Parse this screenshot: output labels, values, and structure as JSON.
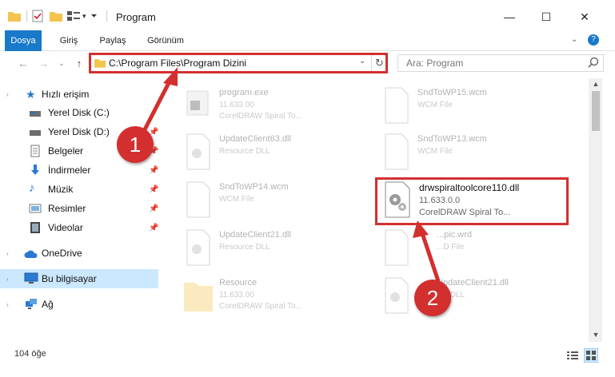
{
  "window": {
    "title": "Program",
    "minimize_glyph": "—",
    "maximize_glyph": "☐",
    "close_glyph": "✕"
  },
  "ribbon": {
    "tabs": [
      {
        "label": "Dosya",
        "active": true
      },
      {
        "label": "Giriş"
      },
      {
        "label": "Paylaş"
      },
      {
        "label": "Görünüm"
      }
    ]
  },
  "address": {
    "path": "C:\\Program Files\\Program Dizini",
    "search_placeholder": "Ara: Program"
  },
  "sidebar": {
    "items": [
      {
        "label": "Hızlı erişim",
        "icon": "star-icon"
      },
      {
        "label": "Yerel Disk (C:)",
        "icon": "drive-icon"
      },
      {
        "label": "Yerel Disk (D:)",
        "icon": "drive-icon",
        "pinned": true
      },
      {
        "label": "Belgeler",
        "icon": "documents-icon",
        "pinned": true
      },
      {
        "label": "İndirmeler",
        "icon": "download-icon",
        "pinned": true
      },
      {
        "label": "Müzik",
        "icon": "music-icon",
        "pinned": true
      },
      {
        "label": "Resimler",
        "icon": "pictures-icon",
        "pinned": true
      },
      {
        "label": "Videolar",
        "icon": "videos-icon",
        "pinned": true
      },
      {
        "label": "OneDrive",
        "icon": "cloud-icon"
      },
      {
        "label": "Bu bilgisayar",
        "icon": "computer-icon",
        "selected": true
      },
      {
        "label": "Ağ",
        "icon": "network-icon"
      }
    ]
  },
  "files": [
    {
      "name": "program.exe",
      "line2": "11.633.00",
      "line3": "CorelDRAW Spiral To...",
      "kind": "exe"
    },
    {
      "name": "SndToWP15.wcm",
      "line2": "WCM File",
      "line3": "",
      "kind": "doc"
    },
    {
      "name": "UpdateClient63.dll",
      "line2": "Resource DLL",
      "line3": "",
      "kind": "dll"
    },
    {
      "name": "SndToWP13.wcm",
      "line2": "WCM File",
      "line3": "",
      "kind": "doc"
    },
    {
      "name": "SndToWP14.wcm",
      "line2": "WCM File",
      "line3": "",
      "kind": "doc"
    },
    {
      "name": "drwspiraltoolcore110.dll",
      "line2": "11.633.0.0",
      "line3": "CorelDRAW Spiral To...",
      "kind": "dll",
      "highlight": true
    },
    {
      "name": "UpdateClient21.dll",
      "line2": "Resource DLL",
      "line3": "",
      "kind": "dll"
    },
    {
      "name": "...pic.wrd",
      "line2": "...D File",
      "line3": "",
      "kind": "doc"
    },
    {
      "name": "Resource",
      "line2": "11.633.00",
      "line3": "CorelDRAW Spiral To...",
      "kind": "folder"
    },
    {
      "name": "UpdateClient21.dll",
      "line2": "...e DLL",
      "line3": "",
      "kind": "dll"
    }
  ],
  "status": {
    "count": "104 öğe"
  },
  "callouts": [
    "1",
    "2"
  ],
  "colors": {
    "accent": "#1979ca",
    "highlight": "#d32f2f",
    "selection": "#cce8ff"
  }
}
